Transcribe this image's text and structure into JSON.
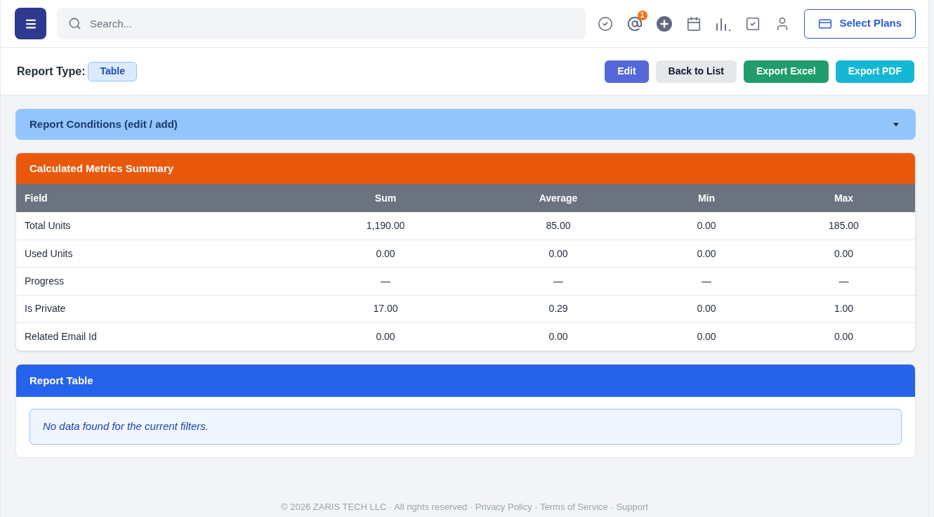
{
  "header": {
    "search": {
      "placeholder": "Search..."
    },
    "mentions_count": "1",
    "plans_button": "Select Plans"
  },
  "report_type": {
    "label": "Report Type:",
    "value": "Table"
  },
  "actions": [
    {
      "label": "Edit",
      "kind": "primary"
    },
    {
      "label": "Back to List",
      "kind": "secondary"
    },
    {
      "label": "Export Excel",
      "kind": "success"
    },
    {
      "label": "Export PDF",
      "kind": "info"
    }
  ],
  "conditions": {
    "title": "Report Conditions (edit / add)",
    "expanded": false
  },
  "metrics": {
    "title": "Calculated Metrics Summary",
    "columns": [
      "Field",
      "Sum",
      "Average",
      "Min",
      "Max"
    ],
    "rows": [
      [
        "Total Units",
        "1,190.00",
        "85.00",
        "0.00",
        "185.00"
      ],
      [
        "Used Units",
        "0.00",
        "0.00",
        "0.00",
        "0.00"
      ],
      [
        "Progress",
        "—",
        "—",
        "—",
        "—"
      ],
      [
        "Is Private",
        "17.00",
        "0.29",
        "0.00",
        "1.00"
      ],
      [
        "Related Email Id",
        "0.00",
        "0.00",
        "0.00",
        "0.00"
      ]
    ]
  },
  "report_table": {
    "title": "Report Table",
    "message": "No data found for the current filters."
  },
  "footer": {
    "text": "© 2026 ZARIS TECH LLC · All rights reserved",
    "separator": "·",
    "links": [
      "Privacy Policy",
      "Terms of Service",
      "Support"
    ]
  }
}
